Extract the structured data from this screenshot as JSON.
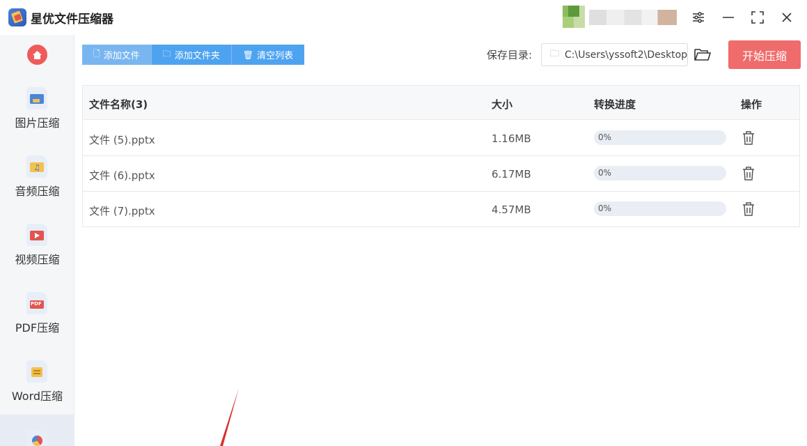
{
  "app": {
    "title": "星优文件压缩器"
  },
  "sidebar": {
    "items": [
      {
        "label": "图片压缩",
        "icon": "image-icon",
        "color": "#4a86d9"
      },
      {
        "label": "音频压缩",
        "icon": "music-icon",
        "color": "#f2c14e"
      },
      {
        "label": "视频压缩",
        "icon": "video-icon",
        "color": "#e0554f"
      },
      {
        "label": "PDF压缩",
        "icon": "pdf-icon",
        "color": "#e0554f"
      },
      {
        "label": "Word压缩",
        "icon": "word-icon",
        "color": "#f2c14e"
      }
    ],
    "pdf_icon_text": "PDF"
  },
  "toolbar": {
    "add_file": "添加文件",
    "add_folder": "添加文件夹",
    "clear_list": "清空列表",
    "save_label": "保存目录:",
    "save_path": "C:\\Users\\yssoft2\\Desktop",
    "start": "开始压缩"
  },
  "table": {
    "headers": {
      "name": "文件名称(3)",
      "size": "大小",
      "progress": "转换进度",
      "action": "操作"
    },
    "rows": [
      {
        "name": "文件 (5).pptx",
        "size": "1.16MB",
        "progress_text": "0%",
        "progress": 0
      },
      {
        "name": "文件 (6).pptx",
        "size": "6.17MB",
        "progress_text": "0%",
        "progress": 0
      },
      {
        "name": "文件 (7).pptx",
        "size": "4.57MB",
        "progress_text": "0%",
        "progress": 0
      }
    ]
  },
  "colors": {
    "accent_blue": "#4ea3f0",
    "start_red": "#f06b6b",
    "home_red": "#ee5b59"
  }
}
